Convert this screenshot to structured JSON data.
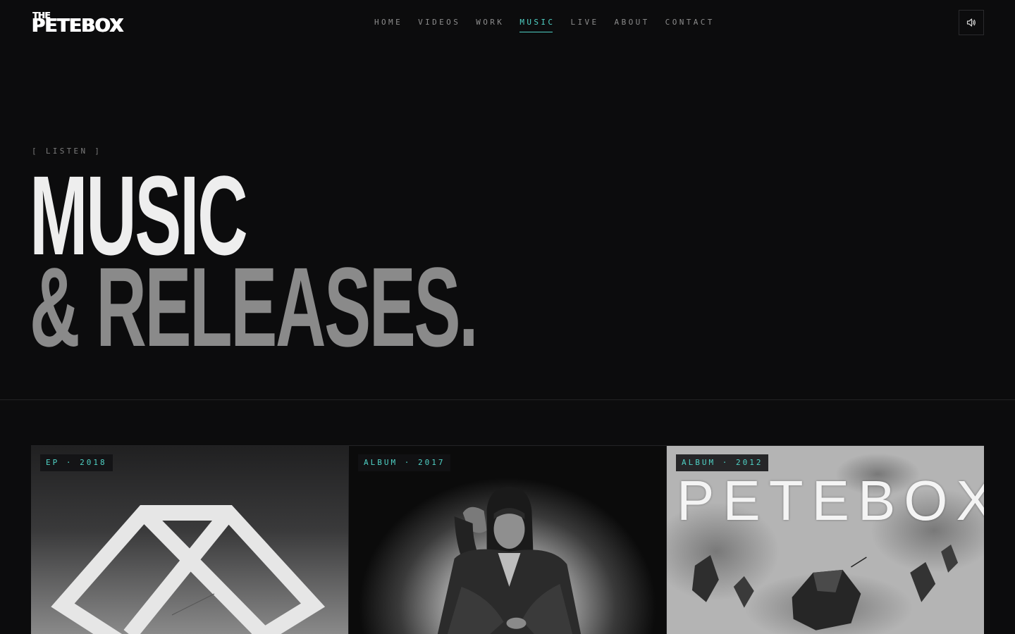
{
  "brand": {
    "small": "THE",
    "name": "PETEBOX"
  },
  "nav": {
    "items": [
      {
        "label": "HOME",
        "active": false
      },
      {
        "label": "VIDEOS",
        "active": false
      },
      {
        "label": "WORK",
        "active": false
      },
      {
        "label": "MUSIC",
        "active": true
      },
      {
        "label": "LIVE",
        "active": false
      },
      {
        "label": "ABOUT",
        "active": false
      },
      {
        "label": "CONTACT",
        "active": false
      }
    ],
    "sound_icon": "speaker-icon"
  },
  "hero": {
    "eyebrow": "[ LISTEN ]",
    "title_line1": "MUSIC",
    "title_line2": "& RELEASES."
  },
  "releases": [
    {
      "badge": "EP · 2018",
      "art_icon": "cube-outline-icon"
    },
    {
      "badge": "ALBUM · 2017",
      "art_icon": "hooded-figure-portrait"
    },
    {
      "badge": "ALBUM · 2012",
      "cover_text": "PETEBOX",
      "art_icon": "geometric-rocks-art"
    }
  ],
  "colors": {
    "background": "#0c0c0d",
    "accent": "#4fd1c5",
    "text_primary": "#eeeeee",
    "text_muted": "#8a8a8a"
  }
}
